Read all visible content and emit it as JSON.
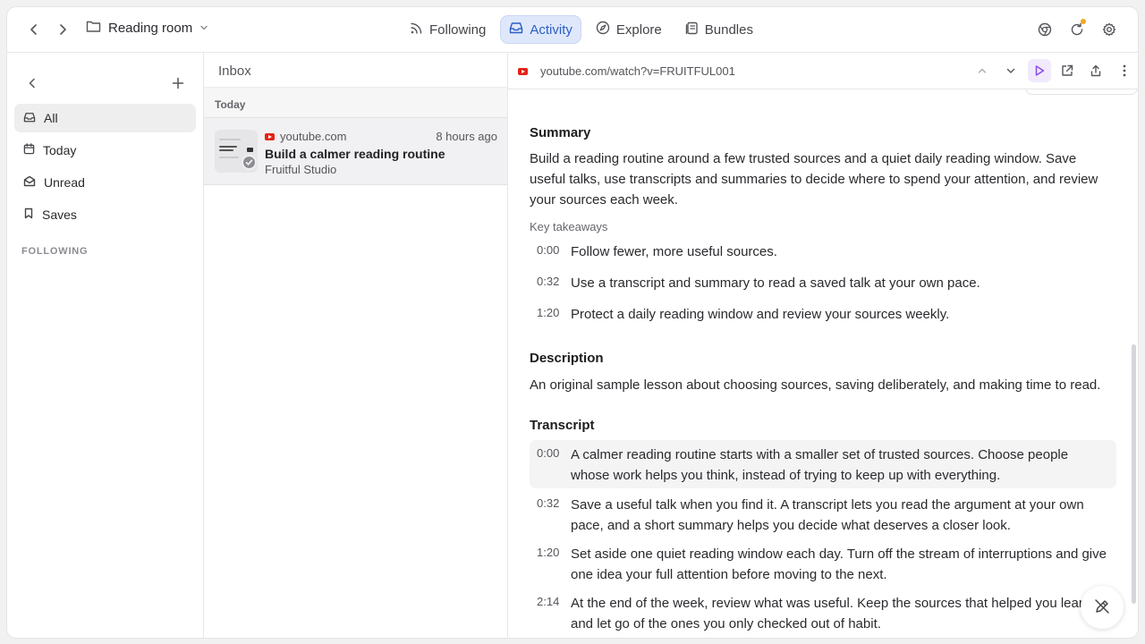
{
  "topbar": {
    "folder_label": "Reading room",
    "tabs": [
      {
        "label": "Following",
        "icon": "rss-icon",
        "active": false
      },
      {
        "label": "Activity",
        "icon": "inbox-icon",
        "active": true
      },
      {
        "label": "Explore",
        "icon": "compass-icon",
        "active": false
      },
      {
        "label": "Bundles",
        "icon": "bundle-icon",
        "active": false
      }
    ],
    "accent_color": "#2d5fc2",
    "notification_dot_color": "#f5a623"
  },
  "sidebar": {
    "items": [
      {
        "label": "All",
        "icon": "inbox-icon",
        "active": true
      },
      {
        "label": "Today",
        "icon": "calendar-icon",
        "active": false
      },
      {
        "label": "Unread",
        "icon": "envelope-icon",
        "active": false
      },
      {
        "label": "Saves",
        "icon": "bookmark-icon",
        "active": false
      }
    ],
    "section_label": "FOLLOWING"
  },
  "inbox": {
    "title": "Inbox",
    "group_label": "Today",
    "items": [
      {
        "source": "youtube.com",
        "time": "8 hours ago",
        "title": "Build a calmer reading routine",
        "author": "Fruitful Studio"
      }
    ]
  },
  "reader": {
    "url": "youtube.com/watch?v=FRUITFUL001",
    "summary": {
      "heading": "Summary",
      "text": "Build a reading routine around a few trusted sources and a quiet daily reading window. Save useful talks, use transcripts and summaries to decide where to spend your attention, and review your sources each week.",
      "takeaways_label": "Key takeaways",
      "takeaways": [
        {
          "time": "0:00",
          "text": "Follow fewer, more useful sources."
        },
        {
          "time": "0:32",
          "text": "Use a transcript and summary to read a saved talk at your own pace."
        },
        {
          "time": "1:20",
          "text": "Protect a daily reading window and review your sources weekly."
        }
      ]
    },
    "description": {
      "heading": "Description",
      "text": "An original sample lesson about choosing sources, saving deliberately, and making time to read."
    },
    "transcript": {
      "heading": "Transcript",
      "rows": [
        {
          "time": "0:00",
          "text": "A calmer reading routine starts with a smaller set of trusted sources. Choose people whose work helps you think, instead of trying to keep up with everything."
        },
        {
          "time": "0:32",
          "text": "Save a useful talk when you find it. A transcript lets you read the argument at your own pace, and a short summary helps you decide what deserves a closer look."
        },
        {
          "time": "1:20",
          "text": "Set aside one quiet reading window each day. Turn off the stream of interruptions and give one idea your full attention before moving to the next."
        },
        {
          "time": "2:14",
          "text": "At the end of the week, review what was useful. Keep the sources that helped you learn, and let go of the ones you only checked out of habit."
        }
      ]
    }
  }
}
